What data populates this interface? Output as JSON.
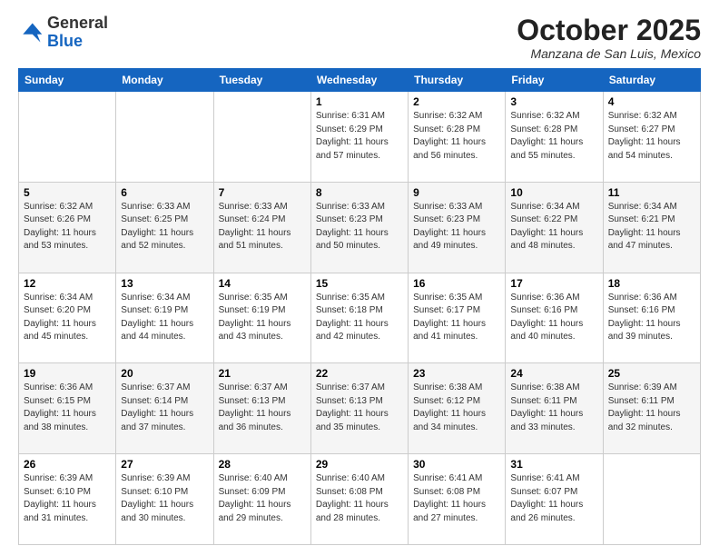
{
  "logo": {
    "general": "General",
    "blue": "Blue"
  },
  "header": {
    "month": "October 2025",
    "location": "Manzana de San Luis, Mexico"
  },
  "days_of_week": [
    "Sunday",
    "Monday",
    "Tuesday",
    "Wednesday",
    "Thursday",
    "Friday",
    "Saturday"
  ],
  "weeks": [
    [
      {
        "day": "",
        "info": ""
      },
      {
        "day": "",
        "info": ""
      },
      {
        "day": "",
        "info": ""
      },
      {
        "day": "1",
        "info": "Sunrise: 6:31 AM\nSunset: 6:29 PM\nDaylight: 11 hours\nand 57 minutes."
      },
      {
        "day": "2",
        "info": "Sunrise: 6:32 AM\nSunset: 6:28 PM\nDaylight: 11 hours\nand 56 minutes."
      },
      {
        "day": "3",
        "info": "Sunrise: 6:32 AM\nSunset: 6:28 PM\nDaylight: 11 hours\nand 55 minutes."
      },
      {
        "day": "4",
        "info": "Sunrise: 6:32 AM\nSunset: 6:27 PM\nDaylight: 11 hours\nand 54 minutes."
      }
    ],
    [
      {
        "day": "5",
        "info": "Sunrise: 6:32 AM\nSunset: 6:26 PM\nDaylight: 11 hours\nand 53 minutes."
      },
      {
        "day": "6",
        "info": "Sunrise: 6:33 AM\nSunset: 6:25 PM\nDaylight: 11 hours\nand 52 minutes."
      },
      {
        "day": "7",
        "info": "Sunrise: 6:33 AM\nSunset: 6:24 PM\nDaylight: 11 hours\nand 51 minutes."
      },
      {
        "day": "8",
        "info": "Sunrise: 6:33 AM\nSunset: 6:23 PM\nDaylight: 11 hours\nand 50 minutes."
      },
      {
        "day": "9",
        "info": "Sunrise: 6:33 AM\nSunset: 6:23 PM\nDaylight: 11 hours\nand 49 minutes."
      },
      {
        "day": "10",
        "info": "Sunrise: 6:34 AM\nSunset: 6:22 PM\nDaylight: 11 hours\nand 48 minutes."
      },
      {
        "day": "11",
        "info": "Sunrise: 6:34 AM\nSunset: 6:21 PM\nDaylight: 11 hours\nand 47 minutes."
      }
    ],
    [
      {
        "day": "12",
        "info": "Sunrise: 6:34 AM\nSunset: 6:20 PM\nDaylight: 11 hours\nand 45 minutes."
      },
      {
        "day": "13",
        "info": "Sunrise: 6:34 AM\nSunset: 6:19 PM\nDaylight: 11 hours\nand 44 minutes."
      },
      {
        "day": "14",
        "info": "Sunrise: 6:35 AM\nSunset: 6:19 PM\nDaylight: 11 hours\nand 43 minutes."
      },
      {
        "day": "15",
        "info": "Sunrise: 6:35 AM\nSunset: 6:18 PM\nDaylight: 11 hours\nand 42 minutes."
      },
      {
        "day": "16",
        "info": "Sunrise: 6:35 AM\nSunset: 6:17 PM\nDaylight: 11 hours\nand 41 minutes."
      },
      {
        "day": "17",
        "info": "Sunrise: 6:36 AM\nSunset: 6:16 PM\nDaylight: 11 hours\nand 40 minutes."
      },
      {
        "day": "18",
        "info": "Sunrise: 6:36 AM\nSunset: 6:16 PM\nDaylight: 11 hours\nand 39 minutes."
      }
    ],
    [
      {
        "day": "19",
        "info": "Sunrise: 6:36 AM\nSunset: 6:15 PM\nDaylight: 11 hours\nand 38 minutes."
      },
      {
        "day": "20",
        "info": "Sunrise: 6:37 AM\nSunset: 6:14 PM\nDaylight: 11 hours\nand 37 minutes."
      },
      {
        "day": "21",
        "info": "Sunrise: 6:37 AM\nSunset: 6:13 PM\nDaylight: 11 hours\nand 36 minutes."
      },
      {
        "day": "22",
        "info": "Sunrise: 6:37 AM\nSunset: 6:13 PM\nDaylight: 11 hours\nand 35 minutes."
      },
      {
        "day": "23",
        "info": "Sunrise: 6:38 AM\nSunset: 6:12 PM\nDaylight: 11 hours\nand 34 minutes."
      },
      {
        "day": "24",
        "info": "Sunrise: 6:38 AM\nSunset: 6:11 PM\nDaylight: 11 hours\nand 33 minutes."
      },
      {
        "day": "25",
        "info": "Sunrise: 6:39 AM\nSunset: 6:11 PM\nDaylight: 11 hours\nand 32 minutes."
      }
    ],
    [
      {
        "day": "26",
        "info": "Sunrise: 6:39 AM\nSunset: 6:10 PM\nDaylight: 11 hours\nand 31 minutes."
      },
      {
        "day": "27",
        "info": "Sunrise: 6:39 AM\nSunset: 6:10 PM\nDaylight: 11 hours\nand 30 minutes."
      },
      {
        "day": "28",
        "info": "Sunrise: 6:40 AM\nSunset: 6:09 PM\nDaylight: 11 hours\nand 29 minutes."
      },
      {
        "day": "29",
        "info": "Sunrise: 6:40 AM\nSunset: 6:08 PM\nDaylight: 11 hours\nand 28 minutes."
      },
      {
        "day": "30",
        "info": "Sunrise: 6:41 AM\nSunset: 6:08 PM\nDaylight: 11 hours\nand 27 minutes."
      },
      {
        "day": "31",
        "info": "Sunrise: 6:41 AM\nSunset: 6:07 PM\nDaylight: 11 hours\nand 26 minutes."
      },
      {
        "day": "",
        "info": ""
      }
    ]
  ]
}
